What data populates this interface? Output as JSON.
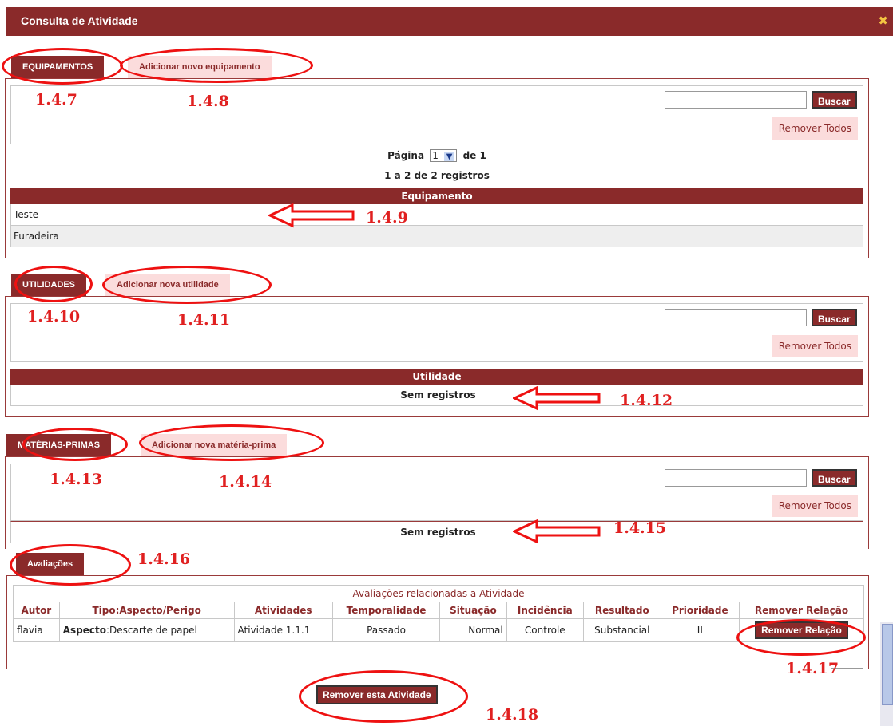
{
  "window": {
    "title": "Consulta de Atividade",
    "close_icon": "close-icon"
  },
  "equipamentos": {
    "tab_label": "EQUIPAMENTOS",
    "add_tab_label": "Adicionar novo equipamento",
    "search_value": "",
    "search_button": "Buscar",
    "remove_all": "Remover Todos",
    "page_label": "Página",
    "page_value": "1",
    "page_of": "de 1",
    "records_summary": "1 a 2 de 2 registros",
    "column_header": "Equipamento",
    "rows": [
      "Teste",
      "Furadeira"
    ]
  },
  "utilidades": {
    "tab_label": "UTILIDADES",
    "add_tab_label": "Adicionar nova utilidade",
    "search_button": "Buscar",
    "remove_all": "Remover Todos",
    "column_header": "Utilidade",
    "empty_text": "Sem registros"
  },
  "materias": {
    "tab_label": "MATÉRIAS-PRIMAS",
    "add_tab_label": "Adicionar nova matéria-prima",
    "search_button": "Buscar",
    "remove_all": "Remover Todos",
    "empty_text": "Sem registros"
  },
  "avaliacoes": {
    "tab_label": "Avaliações",
    "table_title": "Avaliações relacionadas a Atividade",
    "columns": [
      "Autor",
      "Tipo:Aspecto/Perigo",
      "Atividades",
      "Temporalidade",
      "Situação",
      "Incidência",
      "Resultado",
      "Prioridade",
      "Remover Relação"
    ],
    "row": {
      "autor": "flavia",
      "tipo_bold": "Aspecto",
      "tipo_rest": ":Descarte de papel",
      "atividades": "Atividade 1.1.1",
      "temporalidade": "Passado",
      "situacao": "Normal",
      "incidencia": "Controle",
      "resultado": "Substancial",
      "prioridade": "II",
      "remover_button": "Remover Relação"
    }
  },
  "remove_activity_button": "Remover esta Atividade",
  "annotations": {
    "a147": "1.4.7",
    "a148": "1.4.8",
    "a149": "1.4.9",
    "a1410": "1.4.10",
    "a1411": "1.4.11",
    "a1412": "1.4.12",
    "a1413": "1.4.13",
    "a1414": "1.4.14",
    "a1415": "1.4.15",
    "a1416": "1.4.16",
    "a1417": "1.4.17",
    "a1418": "1.4.18"
  },
  "colors": {
    "brand": "#8a2a2a",
    "light_tab": "#fbdcdc",
    "annotation": "#e02020"
  }
}
